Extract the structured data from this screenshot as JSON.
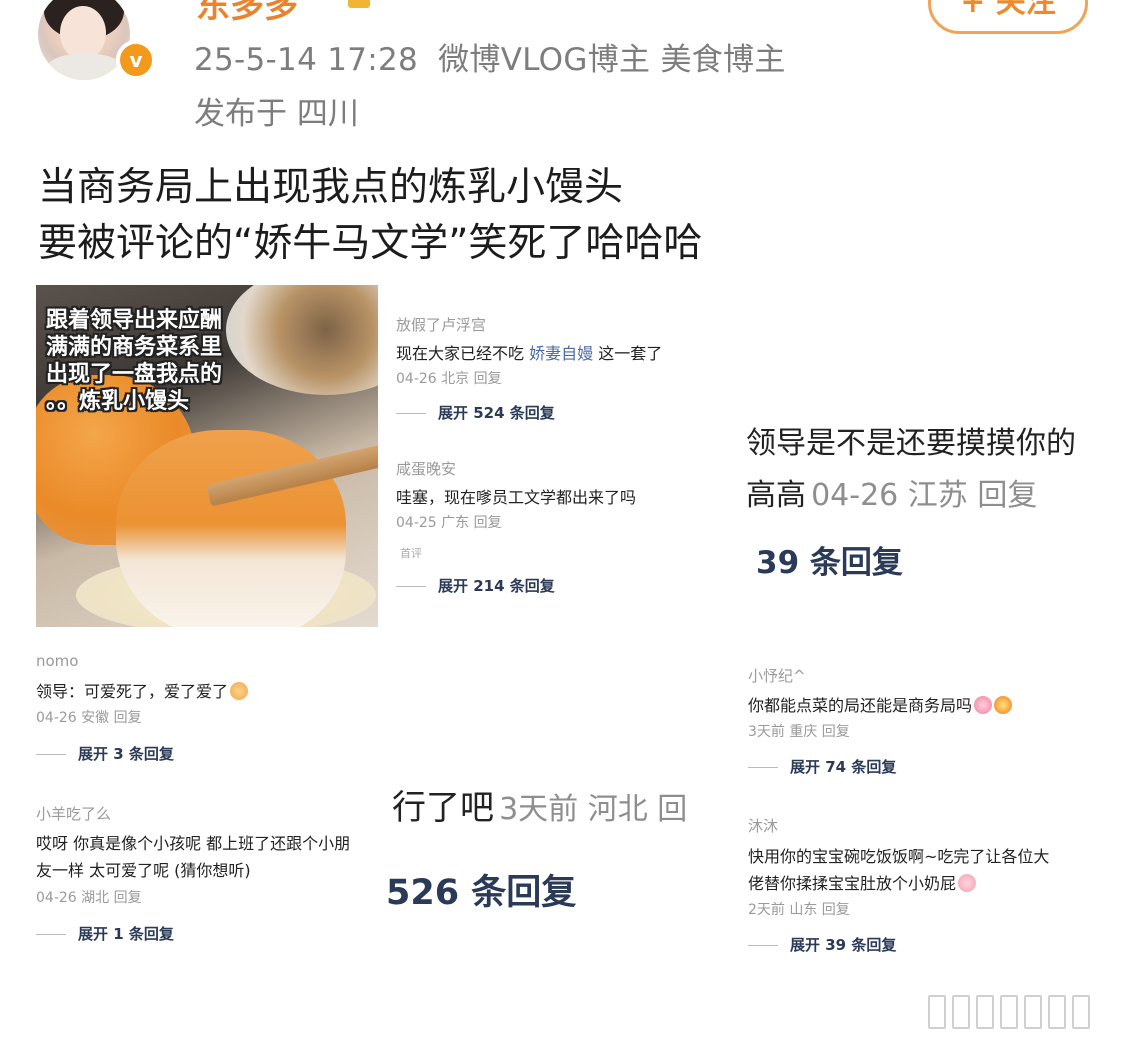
{
  "post": {
    "username": "东多多",
    "follow_label": "+ 关注",
    "date": "25-5-14 17:28",
    "tags": "微博VLOG博主 美食博主",
    "location": "发布于 四川",
    "text_line1": "当商务局上出现我点的炼乳小馒头",
    "text_line2": "要被评论的“娇牛马文学”笑死了哈哈哈"
  },
  "photo": {
    "caption_line1": "跟着领导出来应酬",
    "caption_line2": "满满的商务菜系里",
    "caption_line3": "出现了一盘我点的",
    "caption_line4": "。。炼乳小馒头"
  },
  "comments": {
    "c1": {
      "name": "放假了卢浮宫",
      "text_prefix": "现在大家已经不吃 ",
      "text_highlight": "娇妻自嫚",
      "text_suffix": " 这一套了",
      "meta": "04-26 北京 回复",
      "more": "展开 524 条回复"
    },
    "c2": {
      "name": "咸蛋晚安",
      "text": "哇塞，现在嗲员工文学都出来了吗",
      "meta": "04-25 广东 回复",
      "tag": "首评",
      "more": "展开 214 条回复"
    },
    "c3": {
      "name": "nomo",
      "text": "领导：可爱死了，爱了爱了",
      "meta": "04-26 安徽 回复",
      "more": "展开 3 条回复"
    },
    "c4": {
      "name": "小羊吃了么",
      "text_line1": "哎呀 你真是像个小孩呢 都上班了还跟个小朋",
      "text_line2": "友一样 太可爱了呢 (猜你想听)",
      "meta": "04-26 湖北 回复",
      "more": "展开 1 条回复"
    },
    "c5": {
      "name": "小忬纪^",
      "text": "你都能点菜的局还能是商务局吗",
      "meta": "3天前 重庆 回复",
      "more": "展开 74 条回复"
    },
    "c6": {
      "name": "沐沐",
      "text_line1": "快用你的宝宝碗吃饭饭啊~吃完了让各位大",
      "text_line2": "佬替你揉揉宝宝肚放个小奶屁",
      "meta": "2天前 山东 回复",
      "more": "展开 39 条回复"
    },
    "big_right": {
      "text": "领导是不是还要摸摸你的",
      "name_fragment": "高高",
      "meta": "04-26 江苏 回复",
      "more": "39 条回复"
    },
    "big_middle": {
      "text": "行了吧",
      "meta": "3天前 河北 回",
      "more": "526 条回复"
    }
  }
}
